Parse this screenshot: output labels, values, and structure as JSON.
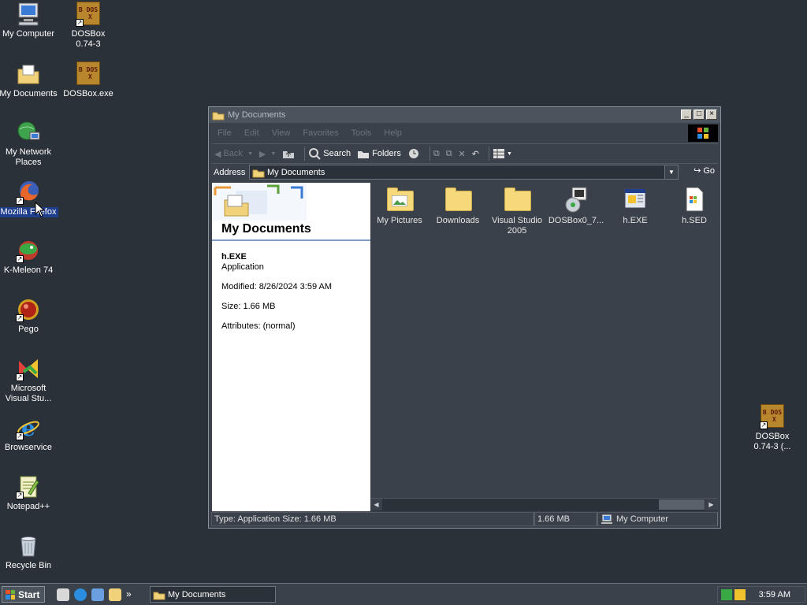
{
  "desktop": {
    "icons": [
      {
        "label": "My Computer"
      },
      {
        "label": "DOSBox 0.74-3"
      },
      {
        "label": "My Documents"
      },
      {
        "label": "DOSBox.exe"
      },
      {
        "label": "My Network Places"
      },
      {
        "label": "Mozilla Firefox"
      },
      {
        "label": "K-Meleon 74"
      },
      {
        "label": "Pego"
      },
      {
        "label": "Microsoft Visual Stu..."
      },
      {
        "label": "Browservice"
      },
      {
        "label": "Notepad++"
      },
      {
        "label": "Recycle Bin"
      },
      {
        "label": "DOSBox 0.74-3 (..."
      }
    ],
    "dosbox_glyphs": [
      "B",
      "D",
      "O",
      "S",
      "X"
    ]
  },
  "window": {
    "title": "My Documents",
    "menu": [
      "File",
      "Edit",
      "View",
      "Favorites",
      "Tools",
      "Help"
    ],
    "toolbar": {
      "back": "Back",
      "search": "Search",
      "folders": "Folders"
    },
    "address": {
      "label": "Address",
      "value": "My Documents",
      "go": "Go"
    },
    "leftpane": {
      "title": "My Documents",
      "selected_name": "h.EXE",
      "selected_type": "Application",
      "modified": "Modified: 8/26/2024 3:59 AM",
      "size": "Size: 1.66 MB",
      "attributes": "Attributes: (normal)"
    },
    "files": [
      {
        "name": "My Pictures",
        "icon": "folder-pictures-icon"
      },
      {
        "name": "Downloads",
        "icon": "folder-icon"
      },
      {
        "name": "Visual Studio 2005",
        "icon": "folder-icon"
      },
      {
        "name": "DOSBox0_7...",
        "icon": "installer-icon"
      },
      {
        "name": "h.EXE",
        "icon": "application-icon"
      },
      {
        "name": "h.SED",
        "icon": "sed-file-icon"
      }
    ],
    "statusbar": {
      "info": "Type: Application Size: 1.66 MB",
      "size": "1.66 MB",
      "zone": "My Computer"
    }
  },
  "taskbar": {
    "start": "Start",
    "task": "My Documents",
    "clock": "3:59 AM",
    "chevron": "»"
  },
  "colors": {
    "desktop": "#2b3139",
    "window_bg": "#3a414a",
    "selection": "#1f3f8c"
  }
}
